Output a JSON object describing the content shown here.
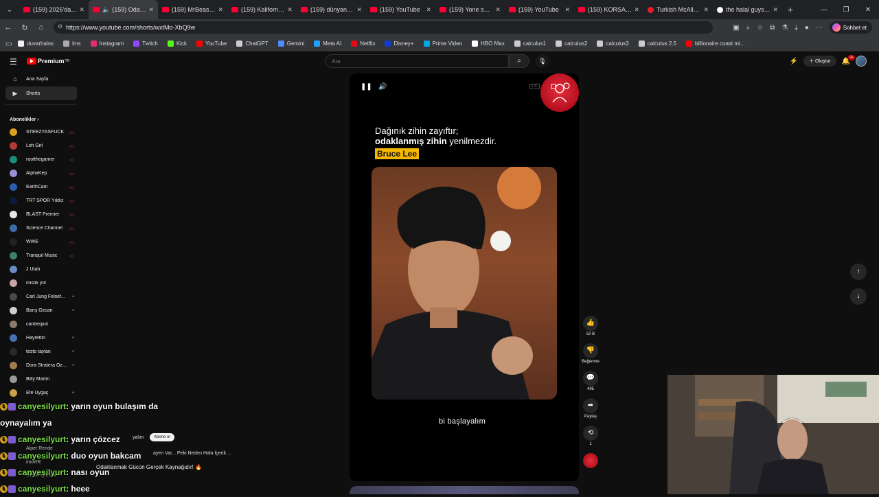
{
  "browser": {
    "tabs": [
      {
        "title": "(159) 2026'da Dü",
        "active": false,
        "kind": "yt"
      },
      {
        "title": "(159) Odakla",
        "active": true,
        "kind": "yt"
      },
      {
        "title": "(159) MrBeast - Y",
        "active": false,
        "kind": "yt"
      },
      {
        "title": "(159) Kaliforniya F",
        "active": false,
        "kind": "yt"
      },
      {
        "title": "(159) dünyanın en",
        "active": false,
        "kind": "yt"
      },
      {
        "title": "(159) YouTube",
        "active": false,
        "kind": "yt"
      },
      {
        "title": "(159) Yone soiled",
        "active": false,
        "kind": "yt"
      },
      {
        "title": "(159) YouTube",
        "active": false,
        "kind": "yt"
      },
      {
        "title": "(159) KORSAN O",
        "active": false,
        "kind": "yt"
      },
      {
        "title": "Turkish McAllen, T",
        "active": false,
        "kind": "cr"
      },
      {
        "title": "the halal guys mc",
        "active": false,
        "kind": "g"
      }
    ],
    "url": "https://www.youtube.com/shorts/wxtMo-XbQ9w",
    "sohbet_label": "Sohbet et",
    "bookmarks": [
      {
        "label": "duvarhalısı",
        "color": "#f1f1f1"
      },
      {
        "label": "lms",
        "color": "#aaaaaa"
      },
      {
        "label": "Instagram",
        "color": "#e1306c"
      },
      {
        "label": "Twitch",
        "color": "#9146ff"
      },
      {
        "label": "Kick",
        "color": "#53fc18"
      },
      {
        "label": "YouTube",
        "color": "#ff0000"
      },
      {
        "label": "ChatGPT",
        "color": "#cccccc"
      },
      {
        "label": "Gemini",
        "color": "#4f8cff"
      },
      {
        "label": "Meta AI",
        "color": "#1fa1ff"
      },
      {
        "label": "Netflix",
        "color": "#e50914"
      },
      {
        "label": "Disney+",
        "color": "#113ccf"
      },
      {
        "label": "Prime Video",
        "color": "#00a8e1"
      },
      {
        "label": "HBO Max",
        "color": "#ffffff"
      },
      {
        "label": "calculus1",
        "color": "#cccccc"
      },
      {
        "label": "calculus2",
        "color": "#cccccc"
      },
      {
        "label": "calculus3",
        "color": "#cccccc"
      },
      {
        "label": "calculus 2.5",
        "color": "#cccccc"
      },
      {
        "label": "billionaire coast mi...",
        "color": "#ff0000"
      }
    ]
  },
  "youtube": {
    "logo_text": "Premium",
    "logo_sup": "TR",
    "search_placeholder": "Ara",
    "create_label": "Oluştur",
    "notif_count": "9+",
    "nav": [
      {
        "label": "Ana Sayfa",
        "icon": "home-icon",
        "selected": false
      },
      {
        "label": "Shorts",
        "icon": "shorts-icon",
        "selected": true
      }
    ],
    "subs_title": "Abonelikler",
    "subscriptions": [
      {
        "name": "STEEZYASFUCK",
        "color": "#d9a11f",
        "mark": "live"
      },
      {
        "name": "Lofi Girl",
        "color": "#b53a3a",
        "mark": "live"
      },
      {
        "name": "rootthegamer",
        "color": "#1a8d7a",
        "mark": "live"
      },
      {
        "name": "AlphaKep",
        "color": "#9a8fd3",
        "mark": "live"
      },
      {
        "name": "EarthCam",
        "color": "#2a5fb0",
        "mark": "live"
      },
      {
        "name": "TRT SPOR Yıldız",
        "color": "#101a3a",
        "mark": "live"
      },
      {
        "name": "BLAST Premier",
        "color": "#e6e6e6",
        "mark": "live"
      },
      {
        "name": "Science Channel",
        "color": "#3d6da8",
        "mark": "live"
      },
      {
        "name": "WWE",
        "color": "#222222",
        "mark": "live"
      },
      {
        "name": "Tranquil Music",
        "color": "#3f7f6f",
        "mark": "live"
      },
      {
        "name": "J Utah",
        "color": "#6a8cc2",
        "mark": "none"
      },
      {
        "name": "mistik yol",
        "color": "#c6a4a4",
        "mark": "none"
      },
      {
        "name": "Carl Jung Felsef...",
        "color": "#4a4a4a",
        "mark": "dot"
      },
      {
        "name": "Barış Özcan",
        "color": "#d0d0d0",
        "mark": "dot"
      },
      {
        "name": "canbeqiuit",
        "color": "#8b7a6a",
        "mark": "none"
      },
      {
        "name": "Hayrettin",
        "color": "#4970b3",
        "mark": "dot"
      },
      {
        "name": "testo taylan",
        "color": "#2a2a2a",
        "mark": "dot"
      },
      {
        "name": "Dora Stratera Öz...",
        "color": "#a07b4e",
        "mark": "dot"
      },
      {
        "name": "Billy Martin",
        "color": "#9a9a9a",
        "mark": "none"
      },
      {
        "name": "Efe Uygaç",
        "color": "#c8a14a",
        "mark": "dot"
      }
    ]
  },
  "short": {
    "quote_line1": "Dağınık zihin zayıftır;",
    "quote_bold": "odaklanmış zihin",
    "quote_rest": " yenilmezdir.",
    "author": "Bruce Lee",
    "watermark": "bi başlayalım",
    "likes": "52 B",
    "dislike_label": "Beğenme",
    "comments": "495",
    "share_label": "Paylaş",
    "remix_count": "1"
  },
  "chat": [
    {
      "user": "canyesilyurt",
      "msg": ": yarın oyun bulaşım da oynayalım ya"
    },
    {
      "user": "canyesilyurt",
      "msg": ": yarın çözcez"
    },
    {
      "user": "canyesilyurt",
      "msg": ": duo oyun bakcam"
    },
    {
      "user": "canyesilyurt",
      "msg": ": nası oyun"
    },
    {
      "user": "canyesilyurt",
      "msg": ": heee"
    }
  ],
  "background_overlay": {
    "abone_label": "Abone ol",
    "ghost1": "yalım",
    "ghost2": "ayen Var... Peki Neden Hala İçerik ...",
    "ghost3": "Odaklanmak Gücün Gerçek Kaynağıdır! 🔥",
    "ghost4": "Alper Rende",
    "ghost5": "imoRR",
    "ghost6": "Orkun Işıtmak"
  }
}
